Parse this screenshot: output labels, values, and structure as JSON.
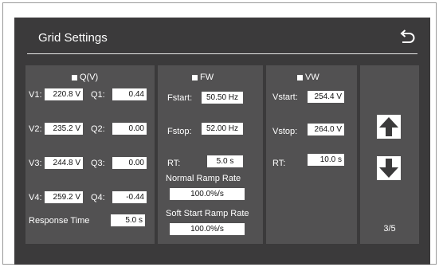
{
  "header": {
    "title": "Grid Settings",
    "back_icon": "undo-arrow-icon"
  },
  "qv": {
    "title": "Q(V)",
    "rows": [
      {
        "v_label": "V1:",
        "v_value": "220.8 V",
        "q_label": "Q1:",
        "q_value": "0.44"
      },
      {
        "v_label": "V2:",
        "v_value": "235.2 V",
        "q_label": "Q2:",
        "q_value": "0.00"
      },
      {
        "v_label": "V3:",
        "v_value": "244.8 V",
        "q_label": "Q3:",
        "q_value": "0.00"
      },
      {
        "v_label": "V4:",
        "v_value": "259.2 V",
        "q_label": "Q4:",
        "q_value": "-0.44"
      }
    ],
    "response_time_label": "Response Time",
    "response_time_value": "5.0 s"
  },
  "fw": {
    "title": "FW",
    "fstart_label": "Fstart:",
    "fstart_value": "50.50 Hz",
    "fstop_label": "Fstop:",
    "fstop_value": "52.00 Hz",
    "rt_label": "RT:",
    "rt_value": "5.0  s",
    "normal_ramp_label": "Normal Ramp Rate",
    "normal_ramp_value": "100.0%/s",
    "soft_ramp_label": "Soft Start Ramp Rate",
    "soft_ramp_value": "100.0%/s"
  },
  "vw": {
    "title": "VW",
    "vstart_label": "Vstart:",
    "vstart_value": "254.4 V",
    "vstop_label": "Vstop:",
    "vstop_value": "264.0 V",
    "rt_label": "RT:",
    "rt_value": "10.0 s"
  },
  "nav": {
    "up_icon": "arrow-up-icon",
    "down_icon": "arrow-down-icon",
    "page": "3/5"
  },
  "colors": {
    "background": "#3b3a3b",
    "panel": "#525152",
    "text": "#ffffff"
  }
}
